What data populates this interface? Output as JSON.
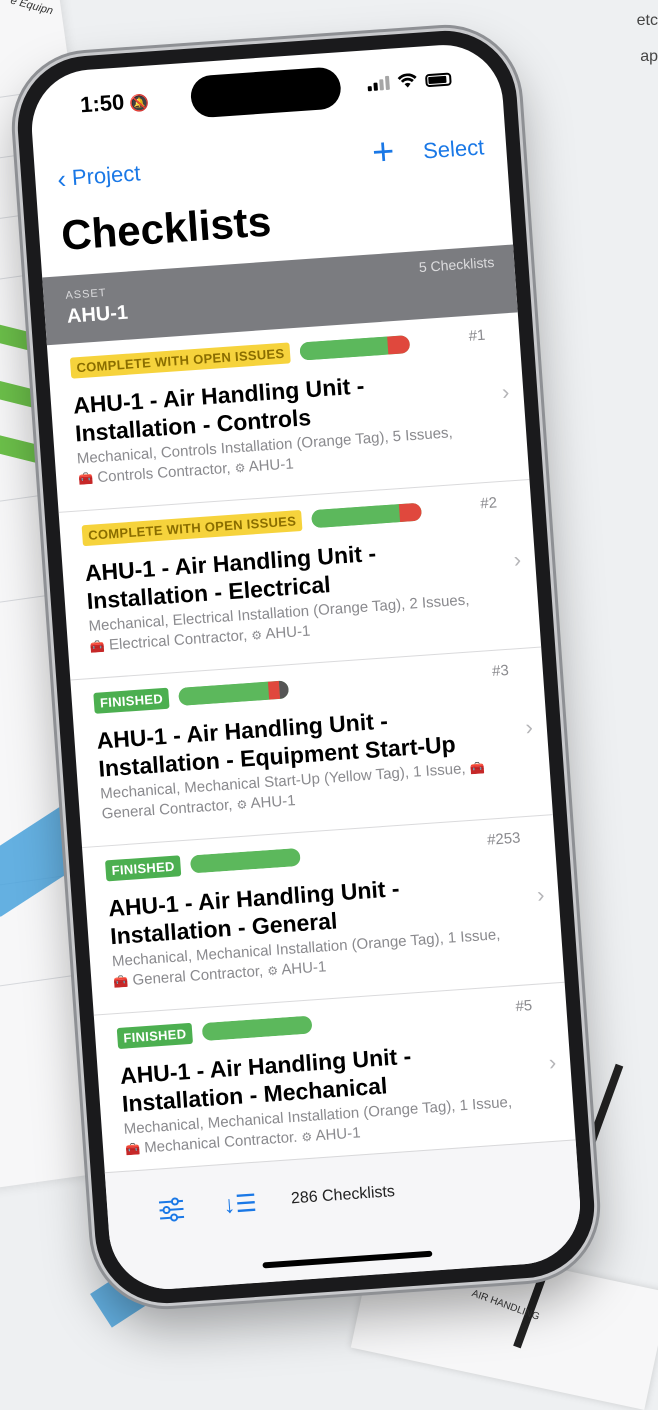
{
  "background": {
    "top_right_text": [
      "etc",
      "ap"
    ],
    "doc_top_label": "e Equipn",
    "doc_bottom_label": "AIR HANDLING"
  },
  "statusbar": {
    "time": "1:50",
    "bell_icon": "bell-slash-icon",
    "signal_icon": "signal-icon",
    "wifi_icon": "wifi-icon",
    "battery_icon": "battery-icon"
  },
  "nav": {
    "back_label": "Project",
    "add_icon": "plus-icon",
    "select_label": "Select"
  },
  "page_title": "Checklists",
  "section": {
    "label": "ASSET",
    "asset": "AHU-1",
    "count": "5 Checklists"
  },
  "colors": {
    "accent": "#1a78e6",
    "badge_yellow": "#f6d33c",
    "badge_green": "#4caf50",
    "progress_red": "#e0483d",
    "section_bg": "#7b7c80"
  },
  "items": [
    {
      "badge": "COMPLETE WITH OPEN ISSUES",
      "badge_style": "yellow",
      "progress_complete": 0.8,
      "progress_issue": 0.2,
      "progress_issue_color": "red",
      "number": "#1",
      "title": "AHU-1 - Air Handling Unit - Installation - Controls",
      "desc_line1": "Mechanical, Controls Installation (Orange Tag), 5 Issues,",
      "desc_line2": "Controls Contractor,",
      "desc_asset": "AHU-1"
    },
    {
      "badge": "COMPLETE WITH OPEN ISSUES",
      "badge_style": "yellow",
      "progress_complete": 0.8,
      "progress_issue": 0.2,
      "progress_issue_color": "red",
      "number": "#2",
      "title": "AHU-1 - Air Handling Unit - Installation - Electrical",
      "desc_line1": "Mechanical, Electrical Installation (Orange Tag), 2 Issues,",
      "desc_line2": "Electrical Contractor,",
      "desc_asset": "AHU-1"
    },
    {
      "badge": "FINISHED",
      "badge_style": "green",
      "progress_complete": 0.82,
      "progress_issue": 0.18,
      "progress_issue_color": "red-dark",
      "number": "#3",
      "title": "AHU-1 - Air Handling Unit - Installation - Equipment Start-Up",
      "desc_line1": "Mechanical, Mechanical Start-Up (Yellow Tag), 1 Issue,",
      "desc_line2": "General Contractor,",
      "desc_asset": "AHU-1"
    },
    {
      "badge": "FINISHED",
      "badge_style": "green",
      "progress_complete": 1.0,
      "progress_issue": 0,
      "progress_issue_color": "none",
      "number": "#253",
      "title": "AHU-1 - Air Handling Unit - Installation - General",
      "desc_line1": "Mechanical, Mechanical Installation (Orange Tag), 1 Issue,",
      "desc_line2": "General Contractor,",
      "desc_asset": "AHU-1"
    },
    {
      "badge": "FINISHED",
      "badge_style": "green",
      "progress_complete": 1.0,
      "progress_issue": 0,
      "progress_issue_color": "none",
      "number": "#5",
      "title": "AHU-1 - Air Handling Unit - Installation - Mechanical",
      "desc_line1": "Mechanical, Mechanical Installation (Orange Tag), 1 Issue,",
      "desc_line2": "Mechanical Contractor.",
      "desc_asset": "AHU-1"
    }
  ],
  "bottombar": {
    "filter_icon": "sliders-icon",
    "sort_icon": "sort-icon",
    "total": "286 Checklists"
  }
}
